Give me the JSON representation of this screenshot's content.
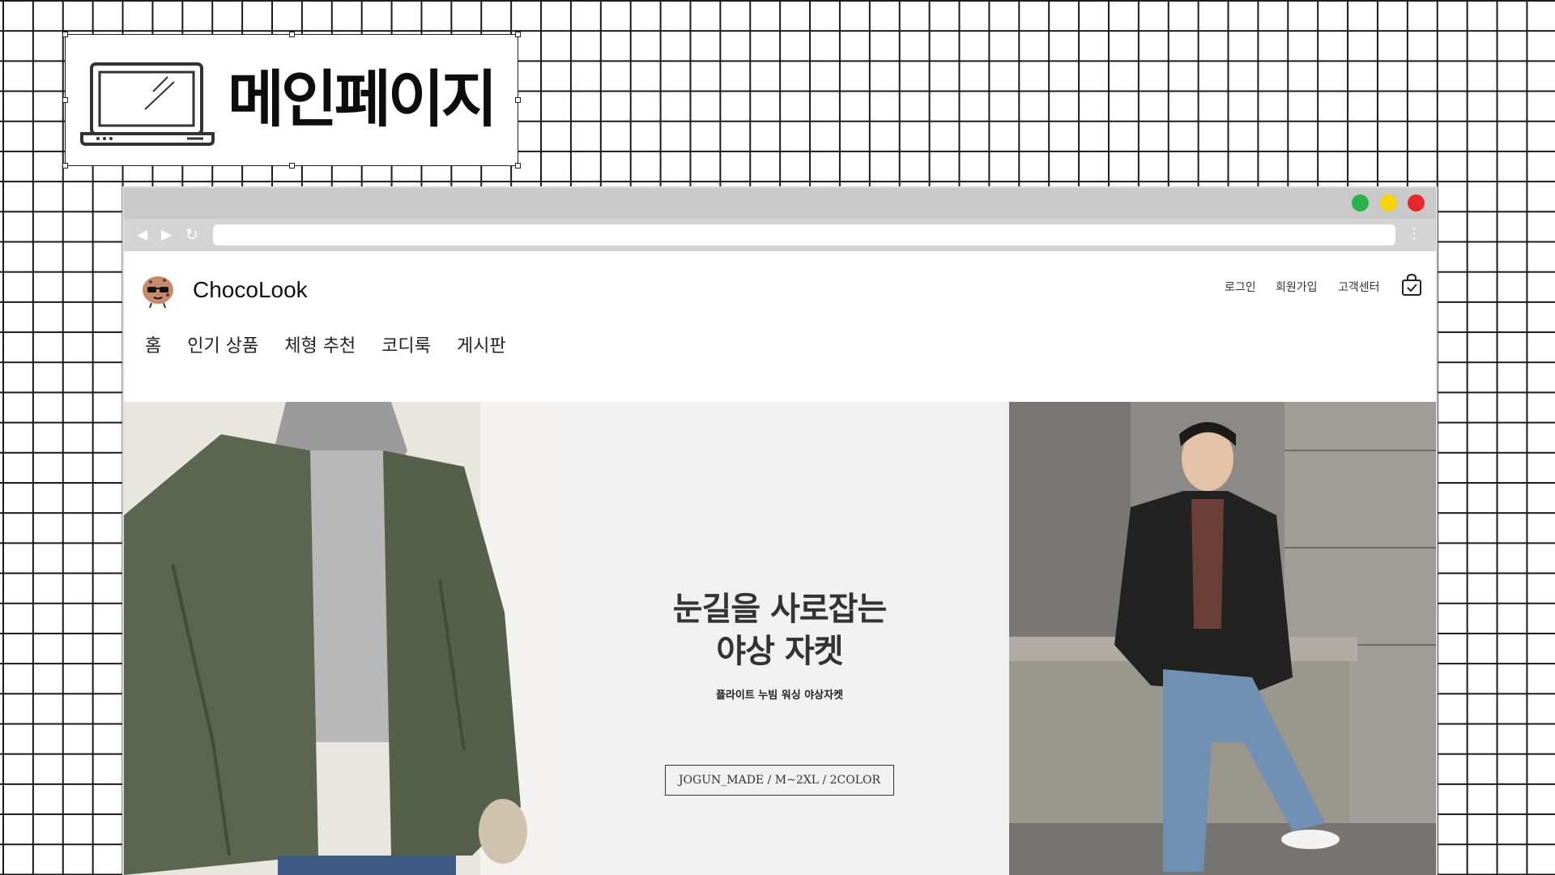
{
  "title_card": {
    "title": "메인페이지",
    "icon": "laptop-icon"
  },
  "browser": {
    "window_buttons": {
      "green": "#27b34a",
      "yellow": "#f5d400",
      "red": "#e8262b"
    },
    "nav": {
      "back": "◀",
      "forward": "▶",
      "reload": "↻",
      "menu": "⋮"
    },
    "address": ""
  },
  "site": {
    "brand": "ChocoLook",
    "utility_links": [
      "로그인",
      "회원가입",
      "고객센터"
    ],
    "nav_items": [
      "홈",
      "인기 상품",
      "체형 추천",
      "코디룩",
      "게시판"
    ]
  },
  "hero": {
    "headline_line1": "눈길을 사로잡는",
    "headline_line2": "야상 자켓",
    "subline": "플라이트 누빔 워싱 야상자켓",
    "tag": "JOGUN_MADE / M~2XL / 2COLOR"
  },
  "colors": {
    "grid": "#1a1a1a",
    "hero_bg": "#f1f1f1",
    "chrome": "#c9c9c9"
  }
}
